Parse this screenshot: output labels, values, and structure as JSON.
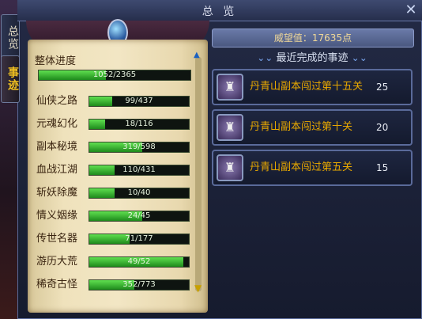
{
  "window": {
    "title": "总 览"
  },
  "tabs": [
    {
      "label": "总览"
    },
    {
      "label": "事迹"
    }
  ],
  "overall": {
    "label": "整体进度",
    "value": "1052/2365",
    "progress": 0.445
  },
  "categories": [
    {
      "label": "仙侠之路",
      "value": "99/437",
      "progress": 0.227
    },
    {
      "label": "元魂幻化",
      "value": "18/116",
      "progress": 0.155
    },
    {
      "label": "副本秘境",
      "value": "319/598",
      "progress": 0.533
    },
    {
      "label": "血战江湖",
      "value": "110/431",
      "progress": 0.255
    },
    {
      "label": "斩妖除魔",
      "value": "10/40",
      "progress": 0.25
    },
    {
      "label": "情义姻缘",
      "value": "24/45",
      "progress": 0.533
    },
    {
      "label": "传世名器",
      "value": "71/177",
      "progress": 0.401
    },
    {
      "label": "游历大荒",
      "value": "49/52",
      "progress": 0.942
    },
    {
      "label": "稀奇古怪",
      "value": "352/773",
      "progress": 0.455
    }
  ],
  "reputation": "威望值：17635点",
  "recent": {
    "label": "最近完成的事迹"
  },
  "achievements": [
    {
      "name": "丹青山副本闯过第十五关",
      "points": "25"
    },
    {
      "name": "丹青山副本闯过第十关",
      "points": "20"
    },
    {
      "name": "丹青山副本闯过第五关",
      "points": "15"
    }
  ]
}
